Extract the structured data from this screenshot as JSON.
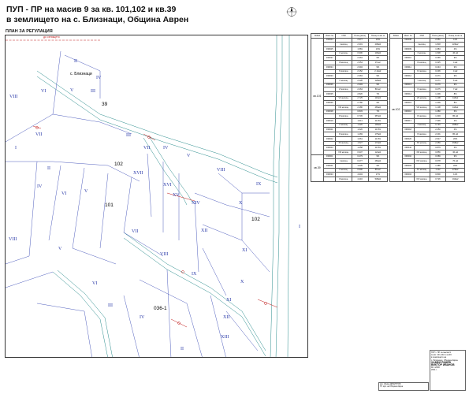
{
  "title": {
    "line1": "ПУП - ПР на  масив 9 за кв. 101,102 и кв.39",
    "line2": "в землището на с. Близнаци, Община Аврен"
  },
  "plan_label": "ПЛАН ЗА РЕГУЛАЦИЯ",
  "map": {
    "village_label": "с. Близнаци",
    "top_red_label": "до селището",
    "quarters": [
      "39",
      "102",
      "101",
      "102",
      "036-1"
    ],
    "parcels": [
      "II",
      "IV",
      "III",
      "V",
      "VI",
      "VIII",
      "VII",
      "I",
      "III",
      "II",
      "IV",
      "V",
      "VI",
      "IV",
      "V",
      "VII",
      "IX",
      "VIII",
      "XVII",
      "XVI",
      "XV",
      "XIV",
      "XII",
      "XI",
      "X",
      "VIII",
      "VII",
      "VI",
      "V",
      "VIII",
      "IX",
      "X",
      "XI",
      "XII",
      "XIII",
      "IV",
      "II",
      "III",
      "I"
    ]
  },
  "area_table": {
    "headers": [
      "ЗОНА",
      "Имот №",
      "УПИ",
      "Площ (кв.м)",
      "Площ по кв. м"
    ],
    "left_blocks": [
      {
        "zone": "кв.101",
        "rows": [
          [
            "",
            "036024",
            "",
            "2.977",
            "13%"
          ],
          [
            "",
            "",
            "I жилищ.",
            "2.301",
            "208м2"
          ],
          [
            "",
            "036025",
            "",
            "1.581",
            "13%"
          ],
          [
            "",
            "",
            "II жилищ.",
            "0.996",
            "106м2"
          ],
          [
            "",
            "036037",
            "",
            "2.364",
            "9%"
          ],
          [
            "",
            "",
            "III жилищ.",
            "2.354",
            "15 м2"
          ],
          [
            "",
            "036034",
            "",
            "2.394",
            "9%"
          ],
          [
            "",
            "",
            "IV жилищ.",
            "2.152",
            "2.11м2"
          ],
          [
            "",
            "036033",
            "",
            "2.363",
            "9%"
          ],
          [
            "",
            "",
            "V жилищ.",
            "2.228",
            "128м2"
          ],
          [
            "",
            "036036",
            "",
            "2.393",
            "9%"
          ],
          [
            "",
            "",
            "VI жилищ.",
            "2.264",
            "86 м2"
          ],
          [
            "",
            "036035",
            "",
            "2.820",
            "7%"
          ],
          [
            "",
            "",
            "VII жилищ.",
            "2.725",
            "119м2"
          ],
          [
            "",
            "036036",
            "",
            "2.780",
            "9%"
          ],
          [
            "",
            "",
            "VIII жилищ.",
            "2.486",
            "283м2"
          ],
          [
            "",
            "036038",
            "",
            "0.833",
            "7%"
          ],
          [
            "",
            "",
            "IX жилищ.",
            "0.745",
            "387м2"
          ],
          [
            "",
            "036019",
            "",
            "1.611",
            "11.8%"
          ],
          [
            "",
            "",
            "X жилищ.",
            "1.420",
            "190м2"
          ],
          [
            "",
            "036021",
            "",
            "1.620",
            "11.8%"
          ],
          [
            "",
            "",
            "XI жилищ.",
            "1.469",
            "175м2"
          ],
          [
            "",
            "036022",
            "",
            "1.661",
            "11.8%"
          ],
          [
            "",
            "",
            "XII жилищ.",
            "1.527",
            "174м2"
          ],
          [
            "",
            "036023",
            "",
            "1.058",
            "11.8%"
          ],
          [
            "",
            "",
            "XIII жилищ.",
            "0.937",
            "124м2"
          ]
        ]
      },
      {
        "zone": "кв.39",
        "rows": [
          [
            "",
            "036001",
            "",
            "0.279",
            "9%"
          ],
          [
            "",
            "",
            "I жилищ.",
            "0.277",
            "282м2"
          ],
          [
            "",
            "036041",
            "",
            "1.035",
            "9%"
          ],
          [
            "",
            "",
            "II жилищ.",
            "0.990",
            "85 м2"
          ],
          [
            "",
            "036033",
            "",
            "4.904",
            "17%"
          ],
          [
            "",
            "",
            "III жилищ.",
            "4.416",
            "538м2"
          ]
        ]
      }
    ],
    "right_blocks": [
      {
        "zone": "кв.102",
        "rows": [
          [
            "",
            "036008",
            "",
            "2.051",
            "11%"
          ],
          [
            "",
            "",
            "I жилищ.",
            "1.818",
            "226м2"
          ],
          [
            "",
            "036009",
            "",
            "1.984",
            "4%"
          ],
          [
            "",
            "",
            "II жилищ.",
            "1.538",
            "46 м2"
          ],
          [
            "",
            "036010",
            "",
            "0.365",
            "9%"
          ],
          [
            "",
            "",
            "III жилищ.",
            "0.325",
            "4 м2"
          ],
          [
            "",
            "036011",
            "",
            "0.243",
            "9%"
          ],
          [
            "",
            "",
            "IV жилищ.",
            "0.236",
            "4 м2"
          ],
          [
            "",
            "036012",
            "",
            "0.271",
            "9%"
          ],
          [
            "",
            "",
            "V жилищ.",
            "0.271",
            "6 м2"
          ],
          [
            "",
            "036013",
            "",
            "0.276",
            "9%"
          ],
          [
            "",
            "",
            "VI жилищ.",
            "0.275",
            "7 м2"
          ],
          [
            "",
            "036014",
            "",
            "1.409",
            "8%"
          ],
          [
            "",
            "",
            "VII жилищ.",
            "1.108",
            "118м2"
          ],
          [
            "",
            "036015",
            "",
            "1.409",
            "8%"
          ],
          [
            "",
            "",
            "VIII жилищ.",
            "1.108",
            "118м2"
          ],
          [
            "",
            "036016",
            "",
            "1.380",
            "6%"
          ],
          [
            "",
            "",
            "IX жилищ.",
            "1.303",
            "86 м2"
          ],
          [
            "",
            "036017",
            "",
            "7.336",
            "4%"
          ],
          [
            "",
            "",
            "X жилищ.",
            "6.745",
            "298м2"
          ],
          [
            "",
            "036018",
            "",
            "2.250",
            "4%"
          ],
          [
            "",
            "",
            "XI жилищ.",
            "2.201",
            "86 м2"
          ],
          [
            "",
            "036020",
            "",
            "2.617",
            "20%"
          ],
          [
            "",
            "",
            "XII жилищ.",
            "2.359",
            "458м2"
          ],
          [
            "",
            "036042",
            "",
            "0.879",
            "4%"
          ],
          [
            "",
            "",
            "XIII жилищ.",
            "0.856",
            "36 м2"
          ],
          [
            "",
            "036002",
            "",
            "0.689",
            "9%"
          ],
          [
            "",
            "",
            "XIV жилищ.",
            "0.678",
            "76 м2"
          ],
          [
            "",
            "036003",
            "",
            "1.385",
            "20%"
          ],
          [
            "",
            "",
            "XV жилищ.",
            "1.112",
            "276м2"
          ],
          [
            "",
            "036004",
            "",
            "0.800",
            "11%"
          ],
          [
            "",
            "",
            "XVI жилищ.",
            "0.726",
            "194м2"
          ]
        ]
      }
    ]
  },
  "title_block": {
    "lines": [
      "ПУП - ПР за масив 9",
      "за кв. 101,102 и кв.39",
      "в землището на",
      "с. Близнаци, Община Аврен"
    ],
    "firm_line1": "ХАМБИ РАНЕВ",
    "firm_line2": "ВИКТОР ИВАНОВ",
    "scale": "М 1:2000",
    "date": "2011 г."
  },
  "stamp_block": {
    "line1": "арх. Ирина ДИМИТРОВ",
    "line2": "ГЛ. арх. на Община Аврен"
  },
  "colors": {
    "road": "#2a8c8c",
    "parcel": "#3b4bb5",
    "regulation": "#c01818",
    "text": "#111111"
  },
  "north_arrow_icon": "north-arrow-icon"
}
